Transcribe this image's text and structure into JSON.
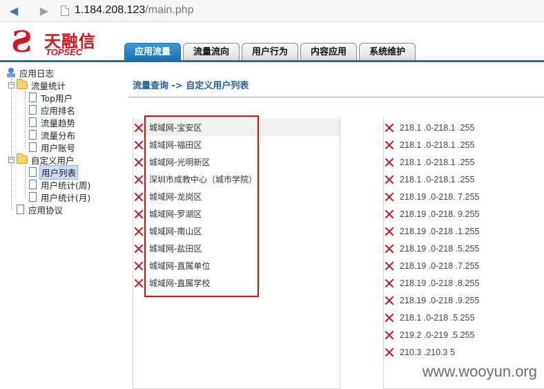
{
  "browser": {
    "url_host": "1.184.208.123",
    "url_path": "/main.php"
  },
  "header": {
    "logo_cn": "天融信",
    "logo_en": "TOPSEC",
    "tabs": [
      {
        "label": "应用流量",
        "active": true
      },
      {
        "label": "流量流向",
        "active": false
      },
      {
        "label": "用户行为",
        "active": false
      },
      {
        "label": "内容应用",
        "active": false
      },
      {
        "label": "系统维护",
        "active": false
      }
    ]
  },
  "sidebar": {
    "root": "应用日志",
    "group1": {
      "label": "流量统计",
      "items": [
        "Top用户",
        "应用排名",
        "流量趋势",
        "流量分布",
        "用户账号"
      ]
    },
    "group2": {
      "label": "自定义用户",
      "items": [
        "用户列表",
        "用户统计(周)",
        "用户统计(月)"
      ],
      "selected": "用户列表"
    },
    "tail": "应用协议"
  },
  "main": {
    "breadcrumb": "流量查询 -> 自定义用户列表",
    "user_groups": [
      "城域网-宝安区",
      "城域网-福田区",
      "城域网-光明新区",
      "深圳市成教中心（城市学院）",
      "城域网-龙岗区",
      "城域网-罗湖区",
      "城域网-南山区",
      "城域网-盐田区",
      "城域网-直属单位",
      "城域网-直属学校"
    ],
    "ip_ranges": [
      "218.1      .0-218.1      .255",
      "218.1      .0-218.1      .255",
      "218.1      .0-218.1      .255",
      "218.1      .0-218.1      .255",
      "218.19      .0-218.      7.255",
      "218.19      .0-218.      9.255",
      "218.19      .0-218      .1.255",
      "218.19      .0-218      .5.255",
      "218.19      .0-218      .7.255",
      "218.19      .0-218      .8.255",
      "218.19      .0-218      .9.255",
      "218.1      .0-218      .5.255",
      "219.2      .0-219      .5.255",
      "210.3      .210.3      5"
    ]
  },
  "watermark": "www.wooyun.org"
}
